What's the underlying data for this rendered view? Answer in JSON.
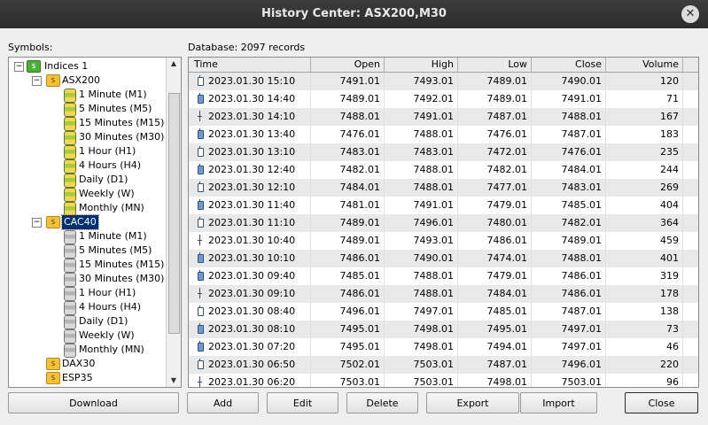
{
  "window": {
    "title": "History Center: ASX200,M30"
  },
  "labels": {
    "symbols": "Symbols:",
    "database": "Database: 2097 records"
  },
  "tree": {
    "root": "Indices 1",
    "groups": [
      {
        "name": "ASX200",
        "items": [
          "1 Minute (M1)",
          "5 Minutes (M5)",
          "15 Minutes (M15)",
          "30 Minutes (M30)",
          "1 Hour (H1)",
          "4 Hours (H4)",
          "Daily (D1)",
          "Weekly (W)",
          "Monthly (MN)"
        ]
      },
      {
        "name": "CAC40",
        "items": [
          "1 Minute (M1)",
          "5 Minutes (M5)",
          "15 Minutes (M15)",
          "30 Minutes (M30)",
          "1 Hour (H1)",
          "4 Hours (H4)",
          "Daily (D1)",
          "Weekly (W)",
          "Monthly (MN)"
        ]
      },
      {
        "name": "DAX30",
        "items": []
      },
      {
        "name": "ESP35",
        "items": []
      }
    ]
  },
  "table": {
    "columns": [
      "Time",
      "Open",
      "High",
      "Low",
      "Close",
      "Volume"
    ],
    "rows": [
      [
        "2023.01.30 15:10",
        "7491.01",
        "7493.01",
        "7489.01",
        "7490.01",
        "120"
      ],
      [
        "2023.01.30 14:40",
        "7489.01",
        "7492.01",
        "7489.01",
        "7491.01",
        "71"
      ],
      [
        "2023.01.30 14:10",
        "7488.01",
        "7491.01",
        "7487.01",
        "7488.01",
        "167"
      ],
      [
        "2023.01.30 13:40",
        "7476.01",
        "7488.01",
        "7476.01",
        "7487.01",
        "183"
      ],
      [
        "2023.01.30 13:10",
        "7483.01",
        "7483.01",
        "7472.01",
        "7476.01",
        "235"
      ],
      [
        "2023.01.30 12:40",
        "7482.01",
        "7488.01",
        "7482.01",
        "7484.01",
        "244"
      ],
      [
        "2023.01.30 12:10",
        "7484.01",
        "7488.01",
        "7477.01",
        "7483.01",
        "269"
      ],
      [
        "2023.01.30 11:40",
        "7481.01",
        "7491.01",
        "7479.01",
        "7485.01",
        "404"
      ],
      [
        "2023.01.30 11:10",
        "7489.01",
        "7496.01",
        "7480.01",
        "7482.01",
        "364"
      ],
      [
        "2023.01.30 10:40",
        "7489.01",
        "7493.01",
        "7486.01",
        "7489.01",
        "459"
      ],
      [
        "2023.01.30 10:10",
        "7486.01",
        "7490.01",
        "7474.01",
        "7488.01",
        "401"
      ],
      [
        "2023.01.30 09:40",
        "7485.01",
        "7488.01",
        "7479.01",
        "7486.01",
        "319"
      ],
      [
        "2023.01.30 09:10",
        "7486.01",
        "7488.01",
        "7484.01",
        "7486.01",
        "178"
      ],
      [
        "2023.01.30 08:40",
        "7496.01",
        "7497.01",
        "7485.01",
        "7487.01",
        "138"
      ],
      [
        "2023.01.30 08:10",
        "7495.01",
        "7498.01",
        "7495.01",
        "7497.01",
        "73"
      ],
      [
        "2023.01.30 07:20",
        "7495.01",
        "7498.01",
        "7494.01",
        "7497.01",
        "46"
      ],
      [
        "2023.01.30 06:50",
        "7502.01",
        "7503.01",
        "7487.01",
        "7496.01",
        "220"
      ],
      [
        "2023.01.30 06:20",
        "7503.01",
        "7503.01",
        "7498.01",
        "7503.01",
        "96"
      ]
    ]
  },
  "buttons": {
    "download": "Download",
    "add": "Add",
    "edit": "Edit",
    "delete": "Delete",
    "export": "Export",
    "import": "Import",
    "close": "Close"
  }
}
